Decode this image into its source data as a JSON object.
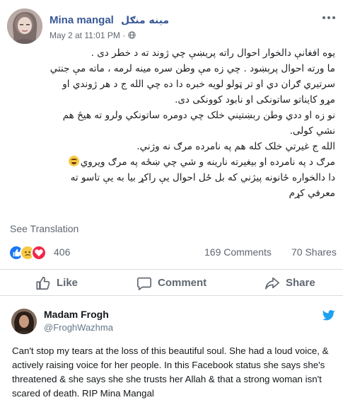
{
  "post": {
    "author_name": "Mina mangal",
    "author_name_native": "مینه منګل",
    "timestamp": "May 2 at 11:01 PM",
    "separator": " · ",
    "privacy_icon": "globe-icon",
    "more_icon": "more-dots-icon",
    "body_lines": [
      "یوه افغانې دالخوار احوال راته پریښې چي ژوند ته د خطر دی .",
      "ما ورته احوال پرېښود . چي زه مې وطن سره مینه لرمه ، ماته مې جنتي",
      "سرتیري ګران دي او تر ټولو لویه خبره دا ده چي الله ج د هر ژوندي او",
      "مړو کایناتو ساتونکی او نابود کوونکی دی.",
      "نو زه  او ددي وطن ربښتیني خلک چي دومره ساتونکي ولرو ته هیڅ هم",
      "نشي کولی.",
      "الله ج غیرتي خلک کله هم په نامرده مرګ نه وژني.",
      "مرګ د په نامرده او بیغیرته نارینه و شي چي ښځه په مرګ ویروي",
      "دا دالخواره ځانونه پیژني که بل ځل احوال یې راکړ بیا به یې تاسو ته",
      "معرفي کړم"
    ],
    "emoji_line_index": 7,
    "see_translation": "See Translation",
    "reaction_count": "406",
    "comments": "169 Comments",
    "shares": "70 Shares",
    "actions": {
      "like": "Like",
      "comment": "Comment",
      "share": "Share"
    }
  },
  "tweet": {
    "name": "Madam Frogh",
    "handle": "@FroghWazhma",
    "text": "Can't stop my tears at the loss of this beautiful soul. She had a loud voice, & actively raising voice for her people. In this Facebook status she says she's threatened & she says she she trusts her Allah & that a strong woman isn't scared of death. RIP Mina Mangal"
  },
  "colors": {
    "facebook_blue": "#385898",
    "like_blue": "#1877f2",
    "love_red": "#f02849",
    "twitter_blue": "#1da1f2",
    "muted_gray": "#606770"
  }
}
